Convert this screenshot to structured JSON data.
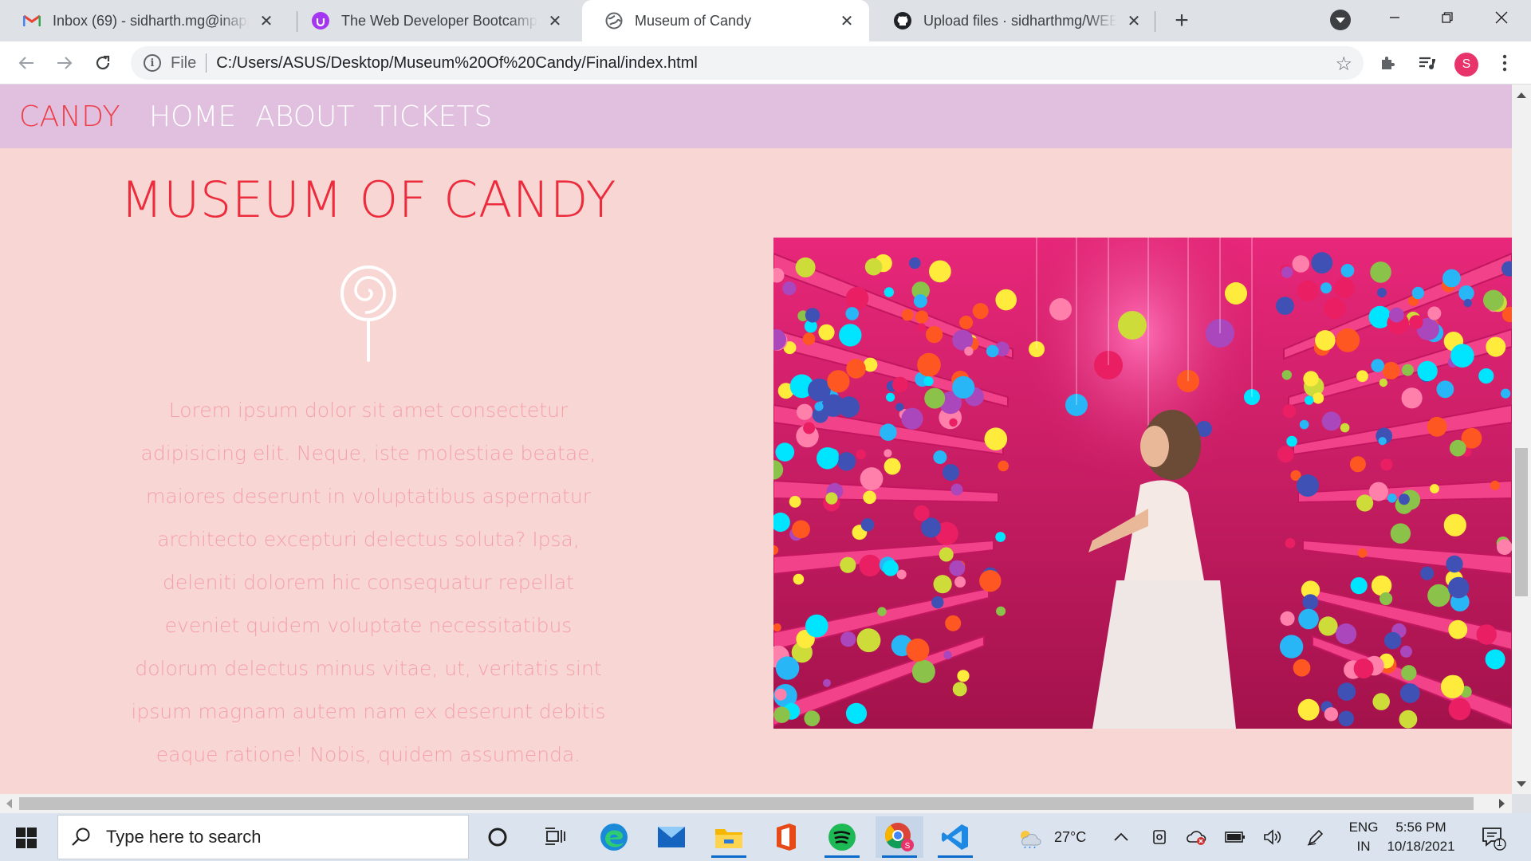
{
  "browser": {
    "tabs": [
      {
        "title": "Inbox (69) - sidharth.mg@inapp.com",
        "favicon": "gmail-icon",
        "active": false
      },
      {
        "title": "The Web Developer Bootcamp 2021",
        "favicon": "udemy-icon",
        "active": false
      },
      {
        "title": "Museum of Candy",
        "favicon": "globe-icon",
        "active": true
      },
      {
        "title": "Upload files · sidharthmg/WEBDEV",
        "favicon": "github-icon",
        "active": false
      }
    ],
    "close_glyph": "✕",
    "new_tab_glyph": "+",
    "address": {
      "scheme": "File",
      "url": "C:/Users/ASUS/Desktop/Museum%20Of%20Candy/Final/index.html"
    },
    "profile_initial": "S"
  },
  "page": {
    "nav": {
      "brand": "CANDY",
      "links": [
        "HOME",
        "ABOUT",
        "TICKETS"
      ]
    },
    "hero": {
      "title": "MUSEUM OF CANDY",
      "icon": "lollipop-icon",
      "body": "Lorem ipsum dolor sit amet consectetur adipisicing elit. Neque, iste molestiae beatae, maiores deserunt in voluptatibus aspernatur architecto excepturi delectus soluta? Ipsa, deleniti dolorem hic consequatur repellat eveniet quidem voluptate necessitatibus dolorum delectus minus vitae, ut, veritatis sint ipsum magnam autem nam ex deserunt debitis eaque ratione! Nobis, quidem assumenda."
    },
    "colors": {
      "background": "#f7d6d3",
      "navbar": "#e0bfdf",
      "brand": "#ee3d46",
      "title": "#ec2c3c",
      "body_text": "#f6a1a9"
    }
  },
  "taskbar": {
    "search_placeholder": "Type here to search",
    "weather": "27°C",
    "language": {
      "line1": "ENG",
      "line2": "IN"
    },
    "time": "5:56 PM",
    "date": "10/18/2021",
    "notification_count": "1"
  }
}
